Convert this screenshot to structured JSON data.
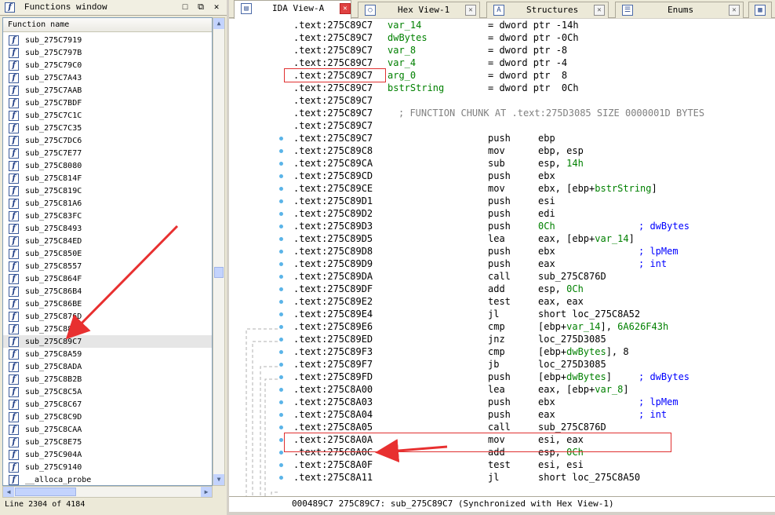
{
  "functions_window": {
    "title": "Functions window",
    "column_header": "Function name",
    "icon_glyph": "f",
    "items": [
      "sub_275C7919",
      "sub_275C797B",
      "sub_275C79C0",
      "sub_275C7A43",
      "sub_275C7AAB",
      "sub_275C7BDF",
      "sub_275C7C1C",
      "sub_275C7C35",
      "sub_275C7DC6",
      "sub_275C7E77",
      "sub_275C8080",
      "sub_275C814F",
      "sub_275C819C",
      "sub_275C81A6",
      "sub_275C83FC",
      "sub_275C8493",
      "sub_275C84ED",
      "sub_275C850E",
      "sub_275C8557",
      "sub_275C864F",
      "sub_275C86B4",
      "sub_275C86BE",
      "sub_275C876D",
      "sub_275C8837",
      "sub_275C89C7",
      "sub_275C8A59",
      "sub_275C8ADA",
      "sub_275C8B2B",
      "sub_275C8C5A",
      "sub_275C8C67",
      "sub_275C8C9D",
      "sub_275C8CAA",
      "sub_275C8E75",
      "sub_275C904A",
      "sub_275C9140",
      "__alloca_probe"
    ],
    "selected_index": 24,
    "status": "Line 2304 of 4184"
  },
  "tabs": [
    {
      "label": "IDA View-A",
      "icon": "ida-view-icon",
      "active": true
    },
    {
      "label": "Hex View-1",
      "icon": "hex-view-icon",
      "active": false
    },
    {
      "label": "Structures",
      "icon": "structures-icon",
      "active": false
    },
    {
      "label": "Enums",
      "icon": "enums-icon",
      "active": false
    }
  ],
  "code_lines": [
    {
      "addr": ".text:275C89C7",
      "var": "var_14",
      "def": "= dword ptr -14h"
    },
    {
      "addr": ".text:275C89C7",
      "var": "dwBytes",
      "def": "= dword ptr -0Ch"
    },
    {
      "addr": ".text:275C89C7",
      "var": "var_8",
      "def": "= dword ptr -8"
    },
    {
      "addr": ".text:275C89C7",
      "var": "var_4",
      "def": "= dword ptr -4"
    },
    {
      "addr": ".text:275C89C7",
      "var": "arg_0",
      "def": "= dword ptr  8"
    },
    {
      "addr": ".text:275C89C7",
      "var": "bstrString",
      "def": "= dword ptr  0Ch"
    },
    {
      "addr": ".text:275C89C7"
    },
    {
      "addr": ".text:275C89C7",
      "chunk": "; FUNCTION CHUNK AT .text:275D3085 SIZE 0000001D BYTES"
    },
    {
      "addr": ".text:275C89C7"
    },
    {
      "addr": ".text:275C89C7",
      "mn": "push",
      "op": "ebp"
    },
    {
      "addr": ".text:275C89C8",
      "mn": "mov",
      "op": "ebp, esp"
    },
    {
      "addr": ".text:275C89CA",
      "mn": "sub",
      "op": "esp, 14h"
    },
    {
      "addr": ".text:275C89CD",
      "mn": "push",
      "op": "ebx"
    },
    {
      "addr": ".text:275C89CE",
      "mn": "mov",
      "op": "ebx, [ebp+bstrString]"
    },
    {
      "addr": ".text:275C89D1",
      "mn": "push",
      "op": "esi"
    },
    {
      "addr": ".text:275C89D2",
      "mn": "push",
      "op": "edi"
    },
    {
      "addr": ".text:275C89D3",
      "mn": "push",
      "op": "0Ch",
      "cmt": "; dwBytes"
    },
    {
      "addr": ".text:275C89D5",
      "mn": "lea",
      "op": "eax, [ebp+var_14]"
    },
    {
      "addr": ".text:275C89D8",
      "mn": "push",
      "op": "ebx",
      "cmt": "; lpMem"
    },
    {
      "addr": ".text:275C89D9",
      "mn": "push",
      "op": "eax",
      "cmt": "; int"
    },
    {
      "addr": ".text:275C89DA",
      "mn": "call",
      "op": "sub_275C876D"
    },
    {
      "addr": ".text:275C89DF",
      "mn": "add",
      "op": "esp, 0Ch"
    },
    {
      "addr": ".text:275C89E2",
      "mn": "test",
      "op": "eax, eax"
    },
    {
      "addr": ".text:275C89E4",
      "mn": "jl",
      "op": "short loc_275C8A52"
    },
    {
      "addr": ".text:275C89E6",
      "mn": "cmp",
      "op": "[ebp+var_14], 6A626F43h"
    },
    {
      "addr": ".text:275C89ED",
      "mn": "jnz",
      "op": "loc_275D3085"
    },
    {
      "addr": ".text:275C89F3",
      "mn": "cmp",
      "op": "[ebp+dwBytes], 8"
    },
    {
      "addr": ".text:275C89F7",
      "mn": "jb",
      "op": "loc_275D3085"
    },
    {
      "addr": ".text:275C89FD",
      "mn": "push",
      "op": "[ebp+dwBytes]",
      "cmt": "; dwBytes"
    },
    {
      "addr": ".text:275C8A00",
      "mn": "lea",
      "op": "eax, [ebp+var_8]"
    },
    {
      "addr": ".text:275C8A03",
      "mn": "push",
      "op": "ebx",
      "cmt": "; lpMem"
    },
    {
      "addr": ".text:275C8A04",
      "mn": "push",
      "op": "eax",
      "cmt": "; int"
    },
    {
      "addr": ".text:275C8A05",
      "mn": "call",
      "op": "sub_275C876D"
    },
    {
      "addr": ".text:275C8A0A",
      "mn": "mov",
      "op": "esi, eax"
    },
    {
      "addr": ".text:275C8A0C",
      "mn": "add",
      "op": "esp, 0Ch"
    },
    {
      "addr": ".text:275C8A0F",
      "mn": "test",
      "op": "esi, esi"
    },
    {
      "addr": ".text:275C8A11",
      "mn": "jl",
      "op": "short loc_275C8A50"
    }
  ],
  "status_bar": "000489C7 275C89C7: sub_275C89C7 (Synchronized with Hex View-1)",
  "colors": {
    "label": "#008000",
    "comment": "#0000ff",
    "highlight_box": "#e03030",
    "arrow": "#e83030"
  }
}
